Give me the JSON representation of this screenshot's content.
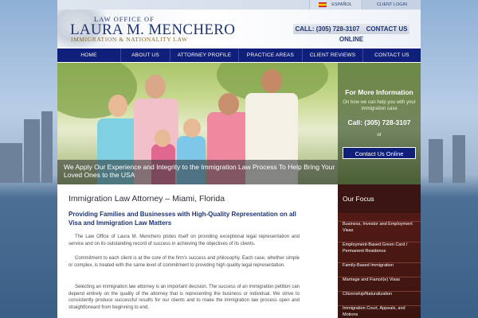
{
  "topbar": {
    "language_label": "ESPAÑOL",
    "login_label": "CLIENT LOGIN"
  },
  "header": {
    "logo_line1": "LAW OFFICE OF",
    "logo_name": "LAURA M. MENCHERO",
    "logo_line3": "IMMIGRATION & NATIONALITY LAW",
    "call_text": "CALL: (305) 728-3107",
    "contact_text": "CONTACT US ONLINE"
  },
  "nav": {
    "items": [
      {
        "label": "HOME"
      },
      {
        "label": "ABOUT US"
      },
      {
        "label": "ATTORNEY PROFILE"
      },
      {
        "label": "PRACTICE AREAS"
      },
      {
        "label": "CLIENT REVIEWS"
      },
      {
        "label": "CONTACT US"
      }
    ]
  },
  "hero": {
    "caption": "We Apply Our Experience and Integrity to the Immigration Law Process To Help Bring Your Loved Ones to the USA",
    "panel_title": "For More Information",
    "panel_sub": "On how we can help you with your immigration case",
    "panel_phone": "Call: (305) 728-3107",
    "panel_or": "or",
    "panel_button": "Contact Us Online"
  },
  "content": {
    "title": "Immigration Law Attorney – Miami, Florida",
    "subtitle": "Providing Families and Businesses with High-Quality Representation on all Visa and Immigration Law Matters",
    "paragraphs": [
      "The Law Office of Laura M. Menchero prides itself on providing exceptional legal representation and service and on its outstanding record of success in achieving the objectives of its clients.",
      "Commitment to each client is at the core of the firm's success and philosophy. Each case, whether simple or complex, is treated with the same level of commitment to providing high quality legal representation.",
      "Selecting an immigration law attorney is an important decision. The success of an immigration petition can depend entirely on the quality of the attorney that is representing the business or individual. We strive to consistently produce successful results for our clients and to make the immigration law process open and straightforward from beginning to end."
    ]
  },
  "sidebar": {
    "title": "Our Focus",
    "items": [
      {
        "label": "Business, Investor and Employment Visas"
      },
      {
        "label": "Employment-Based Green Card / Permanent Residence"
      },
      {
        "label": "Family-Based Immigration"
      },
      {
        "label": "Marriage and Fiancé(e) Visas"
      },
      {
        "label": "Citizenship/Naturalization"
      },
      {
        "label": "Immigration Court, Appeals, and Motions"
      }
    ]
  },
  "colors": {
    "nav_bg": "#0f1f7a",
    "brand_blue": "#1f3470",
    "sidebar_bg": "#5a1c16",
    "accent_gold": "#8a6a2a"
  }
}
